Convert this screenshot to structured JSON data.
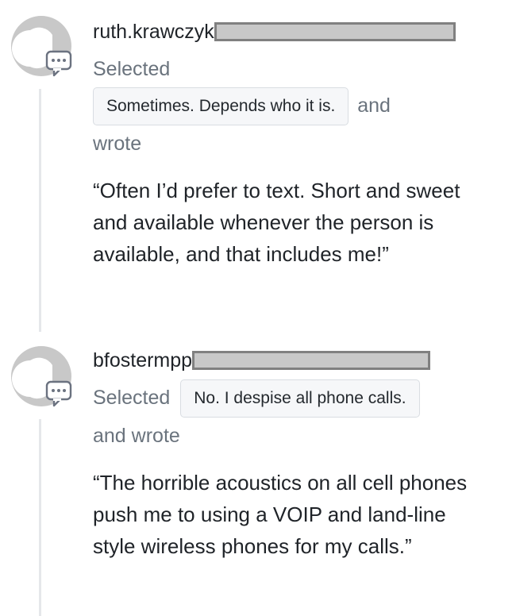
{
  "comments": [
    {
      "username": "ruth.krawczyk",
      "prefix": "Selected",
      "choice": "Sometimes. Depends who it is.",
      "suffix": "and",
      "suffix2": "wrote",
      "quote": "“Often I’d prefer to text. Short and sweet and available whenever the person is available, and that includes me!”"
    },
    {
      "username": "bfostermpp",
      "prefix": "Selected",
      "choice": "No. I despise all phone calls.",
      "suffix": "and wrote",
      "quote": "“The horrible acoustics on all cell phones push me to using a VOIP and land-line style wireless phones for my calls.”"
    }
  ],
  "icons": {
    "avatar": "default-avatar-icon",
    "comment": "comment-bubble-icon"
  },
  "colors": {
    "avatar_gray": "#c8c8c8",
    "thread_line": "#e5e7ea",
    "muted_text": "#6a737d",
    "pill_bg": "#f6f7f9",
    "redaction_fill": "#c8c8c8"
  }
}
